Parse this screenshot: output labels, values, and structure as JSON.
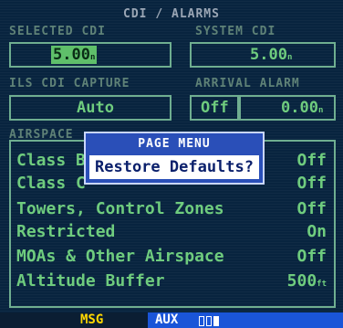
{
  "page": {
    "title": "CDI / ALARMS"
  },
  "selected_cdi": {
    "label": "SELECTED CDI",
    "value": "5.00",
    "unit": "n"
  },
  "system_cdi": {
    "label": "SYSTEM CDI",
    "value": "5.00",
    "unit": "n"
  },
  "ils_capture": {
    "label": "ILS CDI CAPTURE",
    "value": "Auto"
  },
  "arrival_alarm": {
    "label": "ARRIVAL ALARM",
    "state": "Off",
    "value": "0.00",
    "unit": "n"
  },
  "airspace": {
    "label": "AIRSPACE",
    "rows": [
      {
        "name": "Class B",
        "value": "Off"
      },
      {
        "name": "Class C",
        "value": "Off"
      },
      {
        "name": "Towers, Control Zones",
        "value": "Off"
      },
      {
        "name": "Restricted",
        "value": "On"
      },
      {
        "name": "MOAs & Other Airspace",
        "value": "Off"
      },
      {
        "name": "Altitude Buffer",
        "value": "500",
        "unit": "ft"
      }
    ]
  },
  "popup": {
    "title": "PAGE MENU",
    "item": "Restore Defaults?"
  },
  "status": {
    "msg": "MSG",
    "aux": "AUX"
  },
  "colors": {
    "accent": "#6fcc7e",
    "popup": "#2a4fb8",
    "aux": "#1a55d8",
    "msg": "#ffd800"
  }
}
